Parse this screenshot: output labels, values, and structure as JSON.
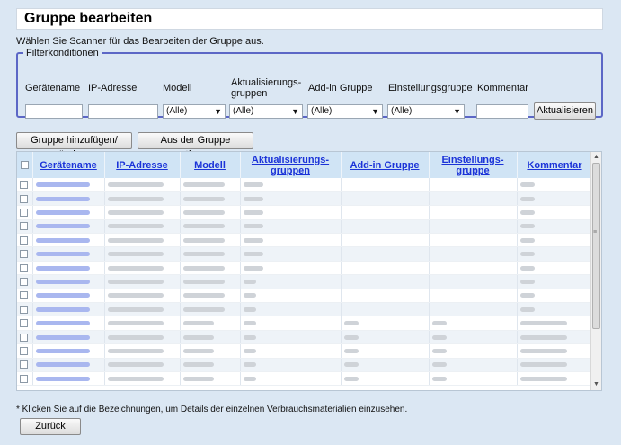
{
  "page": {
    "title": "Gruppe bearbeiten",
    "instruction": "Wählen Sie Scanner für das Bearbeiten der Gruppe aus.",
    "footnote": "* Klicken Sie auf die Bezeichnungen, um Details der einzelnen Verbrauchsmaterialien einzusehen."
  },
  "filter": {
    "legend": "Filterkonditionen",
    "labels": {
      "device_name": "Gerätename",
      "ip": "IP-Adresse",
      "model": "Modell",
      "update_groups": "Aktualisierungs-gruppen",
      "addin_group": "Add-in Gruppe",
      "settings_group": "Einstellungsgruppe",
      "comment": "Kommentar"
    },
    "device_name_value": "",
    "ip_value": "",
    "comment_value": "",
    "model_selected": "(Alle)",
    "update_groups_selected": "(Alle)",
    "addin_group_selected": "(Alle)",
    "settings_group_selected": "(Alle)",
    "refresh_button": "Aktualisieren"
  },
  "actions": {
    "add_change": "Gruppe hinzufügen/ändern",
    "remove": "Aus der Gruppe entfernen",
    "back": "Zurück"
  },
  "table": {
    "headers": {
      "device_name": "Gerätename",
      "ip": "IP-Adresse",
      "model": "Modell",
      "update_groups": "Aktualisierungs-gruppen",
      "addin_group": "Add-in Gruppe",
      "settings_group": "Einstellungs-gruppe",
      "comment": "Kommentar"
    },
    "row_count": 15,
    "redacted_note": "cell values blurred in original"
  },
  "colors": {
    "background": "#dbe7f3",
    "header_bg": "#d0e4f5",
    "link": "#1b33d8",
    "fieldset_border": "#5c67c6"
  }
}
